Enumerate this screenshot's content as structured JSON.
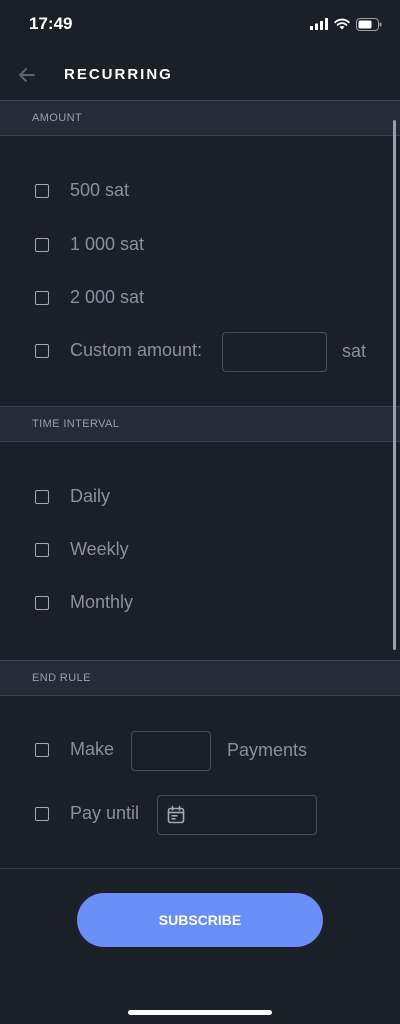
{
  "status_bar": {
    "time": "17:49"
  },
  "header": {
    "title": "RECURRING"
  },
  "amount": {
    "header": "AMOUNT",
    "options": [
      "500 sat",
      "1 000 sat",
      "2 000 sat"
    ],
    "custom_label": "Custom amount:",
    "custom_value": "",
    "custom_suffix": "sat"
  },
  "interval": {
    "header": "TIME INTERVAL",
    "options": [
      "Daily",
      "Weekly",
      "Monthly"
    ]
  },
  "end_rule": {
    "header": "END RULE",
    "make_label": "Make",
    "payments_value": "",
    "payments_suffix": "Payments",
    "pay_until_label": "Pay until",
    "pay_until_value": ""
  },
  "subscribe_label": "SUBSCRIBE"
}
